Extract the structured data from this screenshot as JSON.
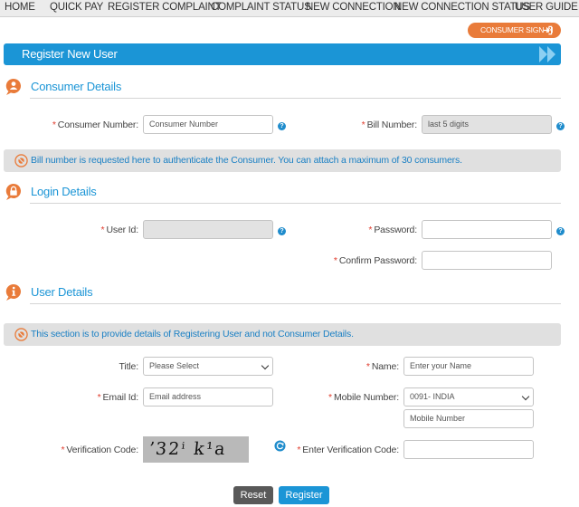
{
  "nav": {
    "items": [
      "HOME",
      "QUICK PAY",
      "REGISTER COMPLAINT",
      "COMPLAINT STATUS",
      "NEW CONNECTION",
      "NEW CONNECTION STATUS",
      "USER GUIDE"
    ]
  },
  "consumer_signin": "CONSUMER SIGN IN",
  "page_title": "Register New User",
  "sections": {
    "consumer": {
      "title": "Consumer Details",
      "consumer_number_label": "Consumer Number:",
      "consumer_number_placeholder": "Consumer Number",
      "bill_number_label": "Bill Number:",
      "bill_number_placeholder": "last 5 digits",
      "info": "Bill number is requested here to authenticate the Consumer. You can attach a maximum of 30 consumers."
    },
    "login": {
      "title": "Login Details",
      "user_id_label": "User Id:",
      "password_label": "Password:",
      "confirm_password_label": "Confirm Password:"
    },
    "user": {
      "title": "User Details",
      "info": "This section is to provide details of Registering User and not Consumer Details.",
      "title_label": "Title:",
      "title_selected": "Please Select",
      "name_label": "Name:",
      "name_placeholder": "Enter your Name",
      "email_label": "Email Id:",
      "email_placeholder": "Email address",
      "mobile_label": "Mobile Number:",
      "country_code_selected": "0091- INDIA",
      "mobile_placeholder": "Mobile Number",
      "verification_label": "Verification Code:",
      "captcha_text": "ʼ32ⁱ k¹a",
      "enter_verification_label": "Enter Verification Code:"
    }
  },
  "buttons": {
    "reset": "Reset",
    "register": "Register"
  },
  "help_glyph": "?",
  "colors": {
    "brand_blue": "#1b95d6",
    "accent_orange": "#e97b3a",
    "required_red": "#e03b2c"
  }
}
